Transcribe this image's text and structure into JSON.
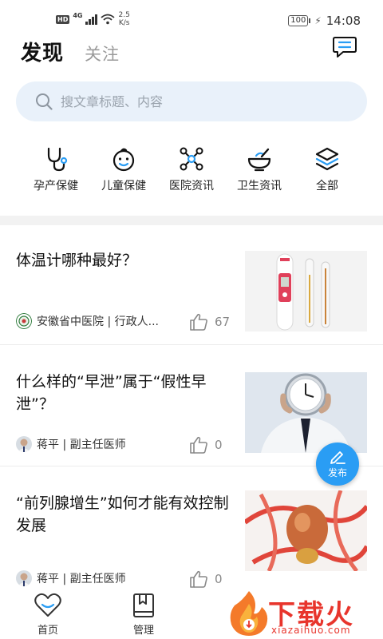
{
  "status_bar": {
    "hd": "HD",
    "network": "4G",
    "speed_value": "2.5",
    "speed_unit": "K/s",
    "battery": "100",
    "time": "14:08"
  },
  "header": {
    "tab_discover": "发现",
    "tab_follow": "关注",
    "message_icon": "chat-bubble-icon"
  },
  "search": {
    "placeholder": "搜文章标题、内容"
  },
  "categories": [
    {
      "label": "孕产保健",
      "icon": "stethoscope-icon"
    },
    {
      "label": "儿童保健",
      "icon": "baby-face-icon"
    },
    {
      "label": "医院资讯",
      "icon": "network-nodes-icon"
    },
    {
      "label": "卫生资讯",
      "icon": "mortar-bowl-icon"
    },
    {
      "label": "全部",
      "icon": "layers-icon"
    }
  ],
  "articles": [
    {
      "title": "体温计哪种最好？",
      "author": "安徽省中医院 | 行政人...",
      "likes": "67"
    },
    {
      "title": "什么样的“早泄”属于“假性早泄”？",
      "author": "蒋平 | 副主任医师",
      "likes": "0"
    },
    {
      "title": "“前列腺增生”如何才能有效控制发展",
      "author": "蒋平 | 副主任医师",
      "likes": "0"
    }
  ],
  "fab": {
    "label": "发布"
  },
  "bottom_nav": {
    "home": "首页",
    "manage": "管理"
  },
  "watermark": {
    "title": "下载火",
    "domain": "xiazaihuo.com"
  },
  "colors": {
    "accent": "#2a9df4",
    "search_bg": "#e9f1fa",
    "watermark": "#e8352c"
  }
}
